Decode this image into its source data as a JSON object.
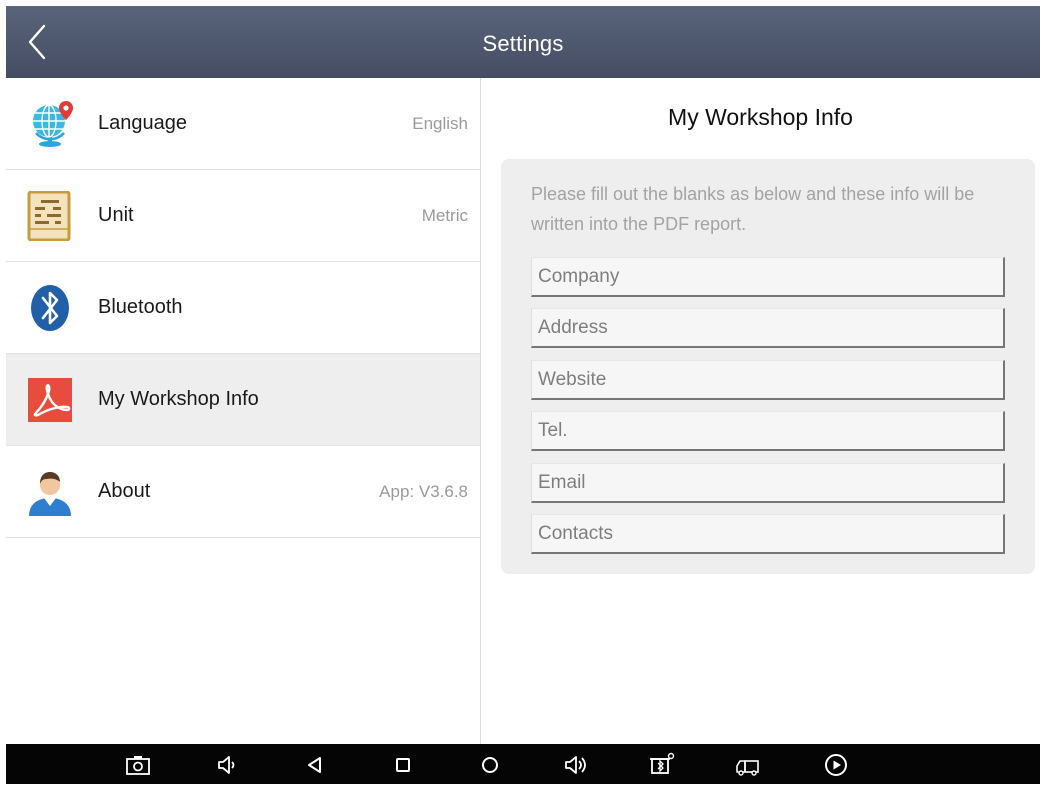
{
  "header": {
    "title": "Settings",
    "back_icon": "chevron-left-icon"
  },
  "menu": {
    "items": [
      {
        "label": "Language",
        "value": "English",
        "icon": "globe-pin-icon"
      },
      {
        "label": "Unit",
        "value": "Metric",
        "icon": "abacus-icon"
      },
      {
        "label": "Bluetooth",
        "value": "",
        "icon": "bluetooth-icon"
      },
      {
        "label": "My Workshop Info",
        "value": "",
        "icon": "pdf-icon",
        "selected": true
      },
      {
        "label": "About",
        "value": "App: V3.6.8",
        "icon": "user-icon"
      }
    ]
  },
  "workshop": {
    "title": "My Workshop Info",
    "description": "Please fill out the blanks as below and these info will be written into the PDF report.",
    "fields": [
      {
        "placeholder": "Company",
        "value": ""
      },
      {
        "placeholder": "Address",
        "value": ""
      },
      {
        "placeholder": "Website",
        "value": ""
      },
      {
        "placeholder": "Tel.",
        "value": ""
      },
      {
        "placeholder": "Email",
        "value": ""
      },
      {
        "placeholder": "Contacts",
        "value": ""
      }
    ]
  },
  "navbar": {
    "buttons": [
      "screenshot-icon",
      "volume-down-icon",
      "back-icon",
      "recent-apps-icon",
      "home-icon",
      "volume-up-icon",
      "vci-bluetooth-icon",
      "vehicle-connect-icon",
      "play-icon"
    ]
  },
  "colors": {
    "header_bg": "#4f5970",
    "selected_row": "#eeeeee",
    "card_bg": "#eeeeee",
    "navbar_bg": "#050505"
  }
}
